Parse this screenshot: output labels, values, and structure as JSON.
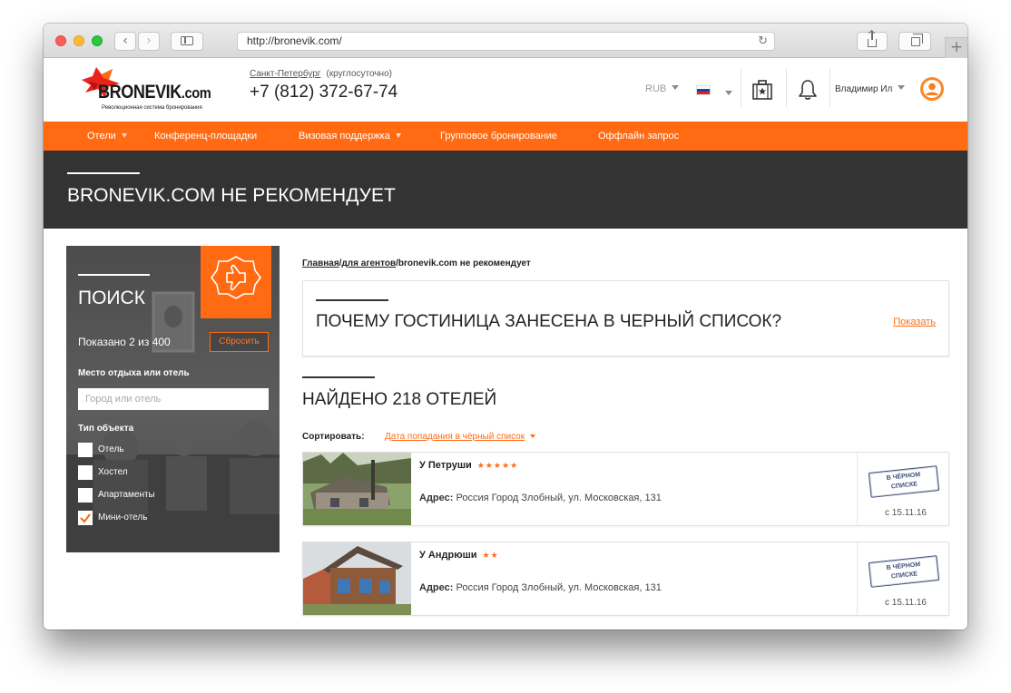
{
  "browser": {
    "url": "http://bronevik.com/"
  },
  "header": {
    "logo_text": "BRONEVIK",
    "logo_suffix": ".com",
    "logo_tagline": "Революционная система бронирования",
    "city": "Санкт-Петербург",
    "hours": "(круглосуточно)",
    "phone": "+7 (812) 372-67-74",
    "currency": "RUB",
    "user_name": "Владимир Ил"
  },
  "nav": {
    "items": [
      {
        "label": "Отели",
        "dropdown": true
      },
      {
        "label": "Конференц-площадки",
        "dropdown": false
      },
      {
        "label": "Визовая поддержка",
        "dropdown": true
      },
      {
        "label": "Групповое бронирование",
        "dropdown": false
      },
      {
        "label": "Оффлайн запрос",
        "dropdown": false
      }
    ]
  },
  "banner": {
    "title": "BRONEVIK.COM НЕ РЕКОМЕНДУЕТ"
  },
  "search": {
    "title": "ПОИСК",
    "shown": "Показано 2 из 400",
    "reset_label": "Сбросить",
    "place_label": "Место отдыха или отель",
    "place_placeholder": "Город или отель",
    "type_label": "Тип объекта",
    "types": [
      {
        "label": "Отель",
        "checked": false
      },
      {
        "label": "Хостел",
        "checked": false
      },
      {
        "label": "Апартаменты",
        "checked": false
      },
      {
        "label": "Мини-отель",
        "checked": true
      }
    ]
  },
  "breadcrumb": {
    "home": "Главная",
    "sep1": "/",
    "agents": "для агентов",
    "sep2": "/",
    "current": "bronevik.com не рекомендует"
  },
  "why": {
    "title": "ПОЧЕМУ ГОСТИНИЦА ЗАНЕСЕНА В ЧЕРНЫЙ СПИСОК?",
    "link": "Показать"
  },
  "results": {
    "title": "НАЙДЕНО 218 ОТЕЛЕЙ",
    "sort_label": "Сортировать:",
    "sort_value": "Дата попадания в чёрный список"
  },
  "hotels": [
    {
      "name": "У Петруши",
      "stars": "★★★★★",
      "address_label": "Адрес:",
      "address": "Россия Город Злобный, ул. Московская, 131",
      "stamp_line1": "В ЧЁРНОМ",
      "stamp_line2": "СПИСКЕ",
      "date": "с 15.11.16"
    },
    {
      "name": "У Андрюши",
      "stars": "★★",
      "address_label": "Адрес:",
      "address": "Россия Город Злобный, ул. Московская, 131",
      "stamp_line1": "В ЧЁРНОМ",
      "stamp_line2": "СПИСКЕ",
      "date": "с 15.11.16"
    }
  ],
  "colors": {
    "accent": "#ff6a13",
    "banner": "#333333",
    "stamp": "#3a4c76"
  }
}
